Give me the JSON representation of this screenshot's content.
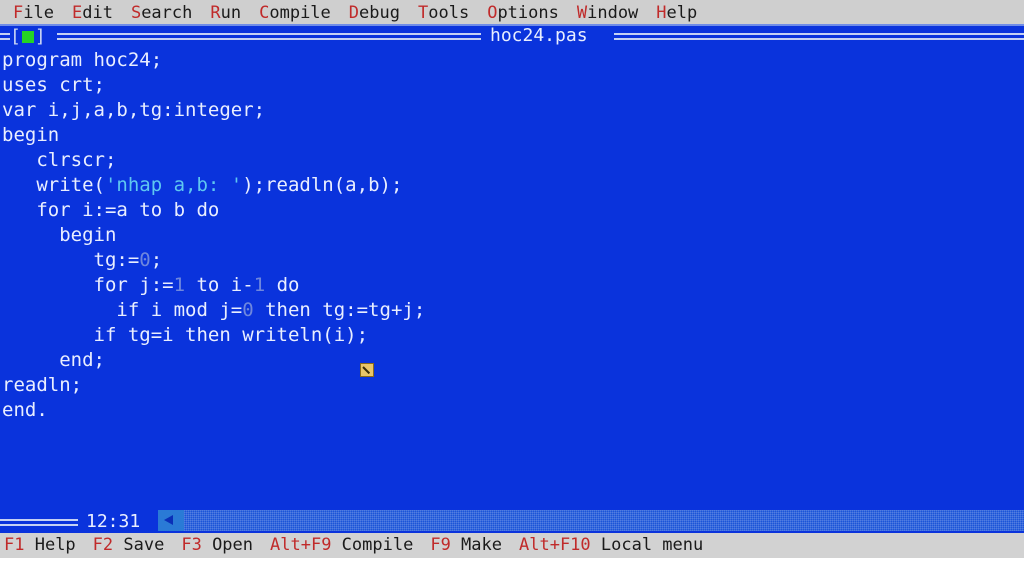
{
  "menubar": {
    "items": [
      {
        "hotkey": "F",
        "rest": "ile",
        "name": "file"
      },
      {
        "hotkey": "E",
        "rest": "dit",
        "name": "edit"
      },
      {
        "hotkey": "S",
        "rest": "earch",
        "name": "search"
      },
      {
        "hotkey": "R",
        "rest": "un",
        "name": "run"
      },
      {
        "hotkey": "C",
        "rest": "ompile",
        "name": "compile"
      },
      {
        "hotkey": "D",
        "rest": "ebug",
        "name": "debug"
      },
      {
        "hotkey": "T",
        "rest": "ools",
        "name": "tools"
      },
      {
        "hotkey": "O",
        "rest": "ptions",
        "name": "options"
      },
      {
        "hotkey": "W",
        "rest": "indow",
        "name": "window"
      },
      {
        "hotkey": "H",
        "rest": "elp",
        "name": "help"
      }
    ]
  },
  "window": {
    "title": "hoc24.pas",
    "close_box_left": "[",
    "close_box_right": "]"
  },
  "editor": {
    "lines": [
      [
        {
          "t": "program hoc24;",
          "c": "plain"
        }
      ],
      [
        {
          "t": "uses crt;",
          "c": "plain"
        }
      ],
      [
        {
          "t": "var i,j,a,b,tg:integer;",
          "c": "plain"
        }
      ],
      [
        {
          "t": "begin",
          "c": "plain"
        }
      ],
      [
        {
          "t": "   clrscr;",
          "c": "plain"
        }
      ],
      [
        {
          "t": "   write(",
          "c": "plain"
        },
        {
          "t": "'nhap a,b: '",
          "c": "str"
        },
        {
          "t": ");readln(a,b);",
          "c": "plain"
        }
      ],
      [
        {
          "t": "   for i:=a to b do",
          "c": "plain"
        }
      ],
      [
        {
          "t": "     begin",
          "c": "plain"
        }
      ],
      [
        {
          "t": "        tg:=",
          "c": "plain"
        },
        {
          "t": "0",
          "c": "num"
        },
        {
          "t": ";",
          "c": "plain"
        }
      ],
      [
        {
          "t": "        for j:=",
          "c": "plain"
        },
        {
          "t": "1",
          "c": "num"
        },
        {
          "t": " to i-",
          "c": "plain"
        },
        {
          "t": "1",
          "c": "num"
        },
        {
          "t": " do",
          "c": "plain"
        }
      ],
      [
        {
          "t": "          if i mod j=",
          "c": "plain"
        },
        {
          "t": "0",
          "c": "num"
        },
        {
          "t": " then tg:=tg+j;",
          "c": "plain"
        }
      ],
      [
        {
          "t": "        if tg=i then writeln(i);",
          "c": "plain"
        }
      ],
      [
        {
          "t": "     end;",
          "c": "plain"
        }
      ],
      [
        {
          "t": "readln;",
          "c": "plain"
        }
      ],
      [
        {
          "t": "end.",
          "c": "plain"
        }
      ]
    ]
  },
  "status": {
    "cursor_position": "12:31"
  },
  "fkeybar": {
    "items": [
      {
        "key": "F1",
        "label": " Help",
        "name": "help"
      },
      {
        "key": "F2",
        "label": " Save",
        "name": "save"
      },
      {
        "key": "F3",
        "label": " Open",
        "name": "open"
      },
      {
        "key": "Alt+F9",
        "label": " Compile",
        "name": "compile"
      },
      {
        "key": "F9",
        "label": " Make",
        "name": "make"
      },
      {
        "key": "Alt+F10",
        "label": " Local menu",
        "name": "local-menu"
      }
    ]
  },
  "colors": {
    "editor_background": "#0a33dc",
    "editor_text": "#e9eeff",
    "string_literal": "#5fc8f0",
    "numeric_literal": "#6f87dd",
    "menubar_background": "#cfcfcf",
    "hotkey_red": "#c02a2a",
    "close_box_green": "#25d425",
    "frame_rule": "#c5d1f4"
  }
}
